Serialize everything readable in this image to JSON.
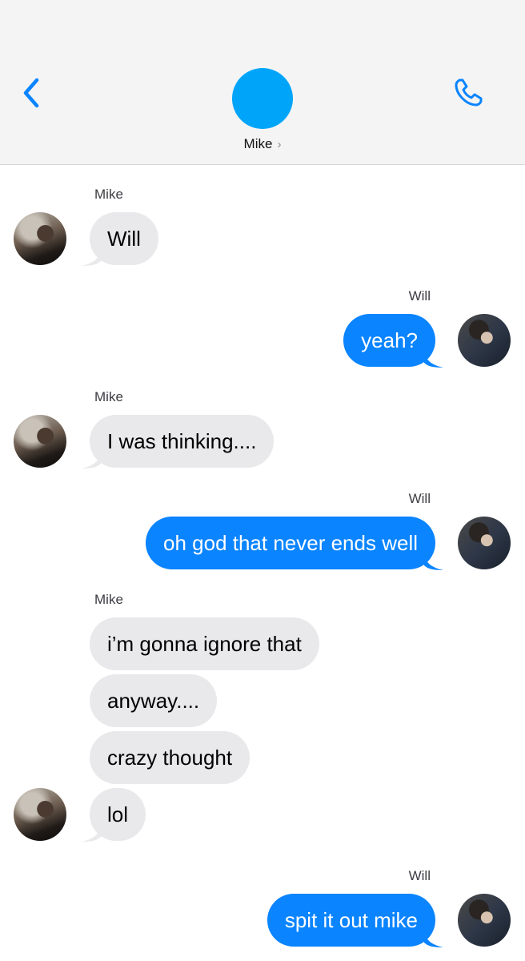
{
  "header": {
    "contact_name": "Mike",
    "chevron": "›",
    "back_icon": "chevron-left-icon",
    "call_icon": "phone-icon",
    "accent_color": "#0a84ff",
    "avatar_color": "#00a5f9"
  },
  "messages": [
    {
      "sender": "Mike",
      "text": "Will"
    },
    {
      "sender": "Will",
      "text": "yeah?"
    },
    {
      "sender": "Mike",
      "text": "I was thinking...."
    },
    {
      "sender": "Will",
      "text": "oh god that never ends well"
    },
    {
      "sender": "Mike",
      "text": "i’m gonna ignore that"
    },
    {
      "text": "anyway...."
    },
    {
      "text": "crazy thought"
    },
    {
      "text": "lol"
    },
    {
      "sender": "Will",
      "text": "spit it out mike"
    }
  ],
  "colors": {
    "incoming_bubble": "#e9e9eb",
    "outgoing_bubble": "#0a84ff"
  }
}
